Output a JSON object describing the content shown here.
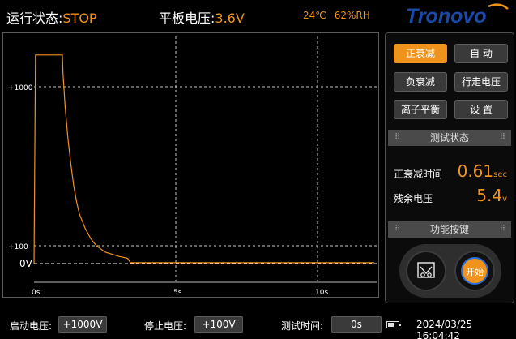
{
  "header": {
    "run_label": "运行状态:",
    "run_value": "STOP",
    "plate_label": "平板电压:",
    "plate_value": "3.6V",
    "temperature": "24℃",
    "humidity": "62%RH",
    "logo_text": "Tronovo"
  },
  "chart_data": {
    "type": "line",
    "title": "",
    "xlabel": "",
    "ylabel": "",
    "x_ticks": [
      "0s",
      "5s",
      "10s"
    ],
    "y_ticks": [
      "+1000",
      "+100",
      "0V"
    ],
    "xlim": [
      0,
      12
    ],
    "series": [
      {
        "color": "#f0931c",
        "x": [
          0,
          0.05,
          1.0,
          1.02,
          1.1,
          1.2,
          1.3,
          1.4,
          1.5,
          1.6,
          1.8,
          2.0,
          2.2,
          2.5,
          3.0,
          3.3,
          3.4,
          4.0,
          6.0,
          8.0,
          10.0,
          12.0
        ],
        "y": [
          0,
          1180,
          1180,
          1080,
          880,
          700,
          560,
          440,
          350,
          280,
          200,
          140,
          100,
          65,
          40,
          30,
          5,
          5,
          5,
          5,
          5,
          5
        ]
      }
    ],
    "colors": {
      "grid": "#c8c8c8",
      "line": "#f0931c",
      "zero_line": "#ffffff"
    }
  },
  "panel": {
    "buttons": [
      {
        "label": "正衰减",
        "active": true
      },
      {
        "label": "自 动",
        "active": false
      },
      {
        "label": "负衰减",
        "active": false
      },
      {
        "label": "行走电压",
        "active": false
      },
      {
        "label": "离子平衡",
        "active": false
      },
      {
        "label": "设 置",
        "active": false
      }
    ],
    "status_title": "测试状态",
    "decay_time_label": "正衰减时间",
    "decay_time_value": "0.61",
    "decay_time_unit": "sec",
    "residual_label": "残余电压",
    "residual_value": "5.4",
    "residual_unit": "v",
    "function_title": "功能按键",
    "start_label": "开始"
  },
  "footer": {
    "start_voltage_label": "启动电压:",
    "start_voltage_value": "+1000V",
    "stop_voltage_label": "停止电压:",
    "stop_voltage_value": "+100V",
    "test_time_label": "测试时间:",
    "test_time_value": "0s",
    "battery_level": 0.5,
    "datetime": "2024/03/25 16:04:42"
  },
  "colors": {
    "accent": "#f0931c",
    "background": "#000000",
    "logo_blue": "#1a4aa8"
  }
}
